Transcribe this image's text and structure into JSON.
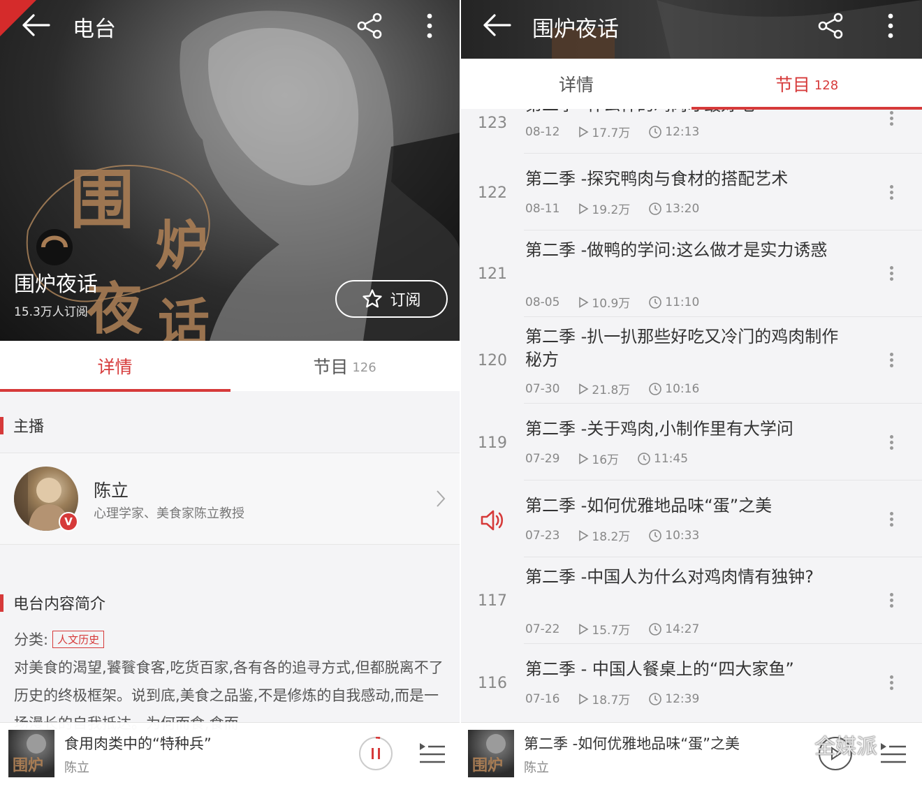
{
  "left": {
    "header": {
      "title": "电台"
    },
    "hero": {
      "title": "围炉夜话",
      "subscribers": "15.3万人订阅",
      "subscribe_label": "订阅",
      "art_text": "围炉夜话"
    },
    "tabs": [
      {
        "label": "详情",
        "count": ""
      },
      {
        "label": "节目",
        "count": "126"
      }
    ],
    "host_section": {
      "title": "主播"
    },
    "host": {
      "name": "陈立",
      "description": "心理学家、美食家陈立教授",
      "badge": "V"
    },
    "intro_section": {
      "title": "电台内容简介"
    },
    "category": {
      "label": "分类:",
      "tag": "人文历史"
    },
    "intro_text": "对美食的渴望,饕餮食客,吃货百家,各有各的追寻方式,但都脱离不了历史的终极框架。说到底,美食之品鉴,不是修炼的自我感动,而是一场漫长的自我抵达。为何而食,食而",
    "player": {
      "title": "食用肉类中的“特种兵”",
      "artist": "陈立"
    }
  },
  "right": {
    "header": {
      "title": "围炉夜话"
    },
    "tabs": [
      {
        "label": "详情",
        "count": ""
      },
      {
        "label": "节目",
        "count": "128"
      }
    ],
    "episodes": [
      {
        "num": "123",
        "title": "第二季 -什么样的鸡肉才最好吃",
        "date": "08-12",
        "plays": "17.7万",
        "duration": "12:13"
      },
      {
        "num": "122",
        "title": "第二季 -探究鸭肉与食材的搭配艺术",
        "date": "08-11",
        "plays": "19.2万",
        "duration": "13:20"
      },
      {
        "num": "121",
        "title": "第二季 -做鸭的学问:这么做才是实力诱惑",
        "date": "08-05",
        "plays": "10.9万",
        "duration": "11:10"
      },
      {
        "num": "120",
        "title": "第二季 -扒一扒那些好吃又冷门的鸡肉制作秘方",
        "date": "07-30",
        "plays": "21.8万",
        "duration": "10:16"
      },
      {
        "num": "119",
        "title": "第二季 -关于鸡肉,小制作里有大学问",
        "date": "07-29",
        "plays": "16万",
        "duration": "11:45"
      },
      {
        "num": "",
        "playing": true,
        "title": "第二季 -如何优雅地品味“蛋”之美",
        "date": "07-23",
        "plays": "18.2万",
        "duration": "10:33"
      },
      {
        "num": "117",
        "title": "第二季 -中国人为什么对鸡肉情有独钟?",
        "date": "07-22",
        "plays": "15.7万",
        "duration": "14:27"
      },
      {
        "num": "116",
        "title": "第二季 - 中国人餐桌上的“四大家鱼”",
        "date": "07-16",
        "plays": "18.7万",
        "duration": "12:39"
      }
    ],
    "player": {
      "title": "第二季 -如何优雅地品味“蛋”之美",
      "artist": "陈立"
    },
    "watermark": "全媒派"
  },
  "colors": {
    "accent": "#d63a3a",
    "text": "#333333",
    "muted": "#888888",
    "background": "#f4f4f6"
  }
}
